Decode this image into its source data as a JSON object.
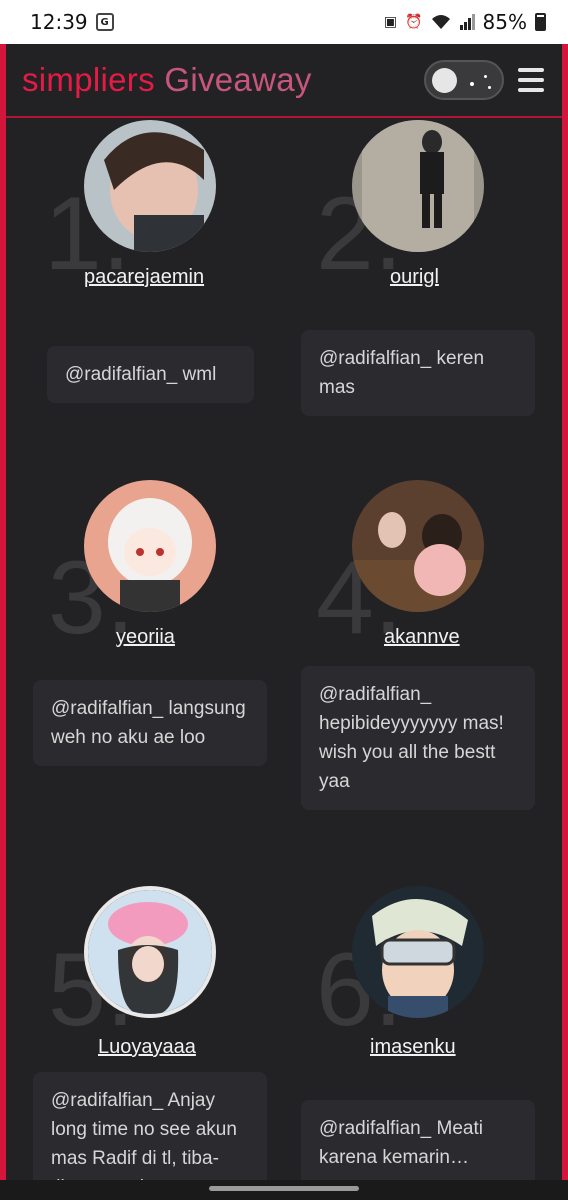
{
  "status": {
    "time": "12:39",
    "battery": "85%",
    "icons": [
      "translate-icon",
      "bug-icon",
      "alarm-icon",
      "wifi-icon",
      "signal-icon",
      "battery-icon"
    ]
  },
  "header": {
    "brand_part1": "simpliers",
    "brand_part2": "Giveaway",
    "toggle_label": "theme-toggle",
    "menu_icon": "hamburger-icon"
  },
  "colors": {
    "accent": "#d4163d",
    "brand_red": "#e41b45",
    "brand_pink": "#c8567a",
    "background": "#222225",
    "bubble": "#2b2b2f"
  },
  "entries": [
    {
      "rank": "1.",
      "username": "pacarejaemin",
      "comment": "@radifalfian_ wml"
    },
    {
      "rank": "2.",
      "username": "ourigl",
      "comment": "@radifalfian_ keren mas"
    },
    {
      "rank": "3.",
      "username": "yeoriia",
      "comment": "@radifalfian_ langsung weh no aku ae loo"
    },
    {
      "rank": "4.",
      "username": "akannve",
      "comment": "@radifalfian_ hepibideyyyyyyy mas! wish you all the bestt yaa"
    },
    {
      "rank": "5.",
      "username": "Luoyayaaa",
      "comment": "@radifalfian_ Anjay long time no see akun mas Radif di tl, tiba-tiba nongol…"
    },
    {
      "rank": "6.",
      "username": "imasenku",
      "comment": "@radifalfian_ Meati karena kemarin…"
    }
  ]
}
